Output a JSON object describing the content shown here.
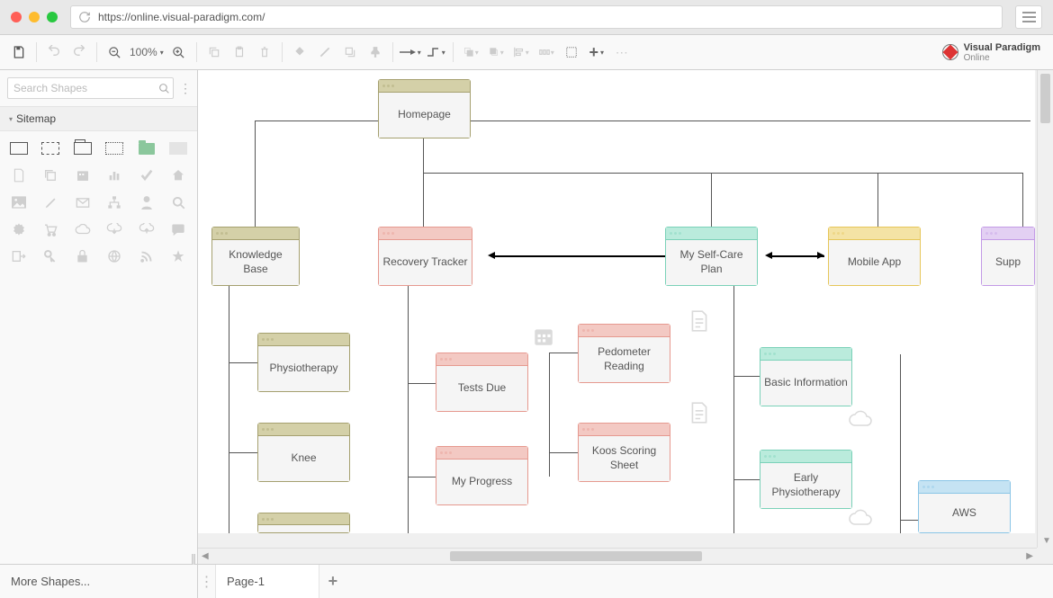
{
  "url": "https://online.visual-paradigm.com/",
  "zoom": "100%",
  "brand_line1": "Visual Paradigm",
  "brand_line2": "Online",
  "search_placeholder": "Search Shapes",
  "section_title": "Sitemap",
  "more_shapes": "More Shapes...",
  "page_tab": "Page-1",
  "nodes": {
    "homepage": "Homepage",
    "knowledge_base": "Knowledge Base",
    "recovery_tracker": "Recovery Tracker",
    "self_care": "My Self-Care Plan",
    "mobile_app": "Mobile App",
    "support": "Supp",
    "physiotherapy": "Physiotherapy",
    "knee": "Knee",
    "tests_due": "Tests Due",
    "my_progress": "My Progress",
    "pedometer": "Pedometer Reading",
    "koos": "Koos Scoring Sheet",
    "basic_info": "Basic Information",
    "early_physio": "Early Physiotherapy",
    "aws": "AWS"
  }
}
